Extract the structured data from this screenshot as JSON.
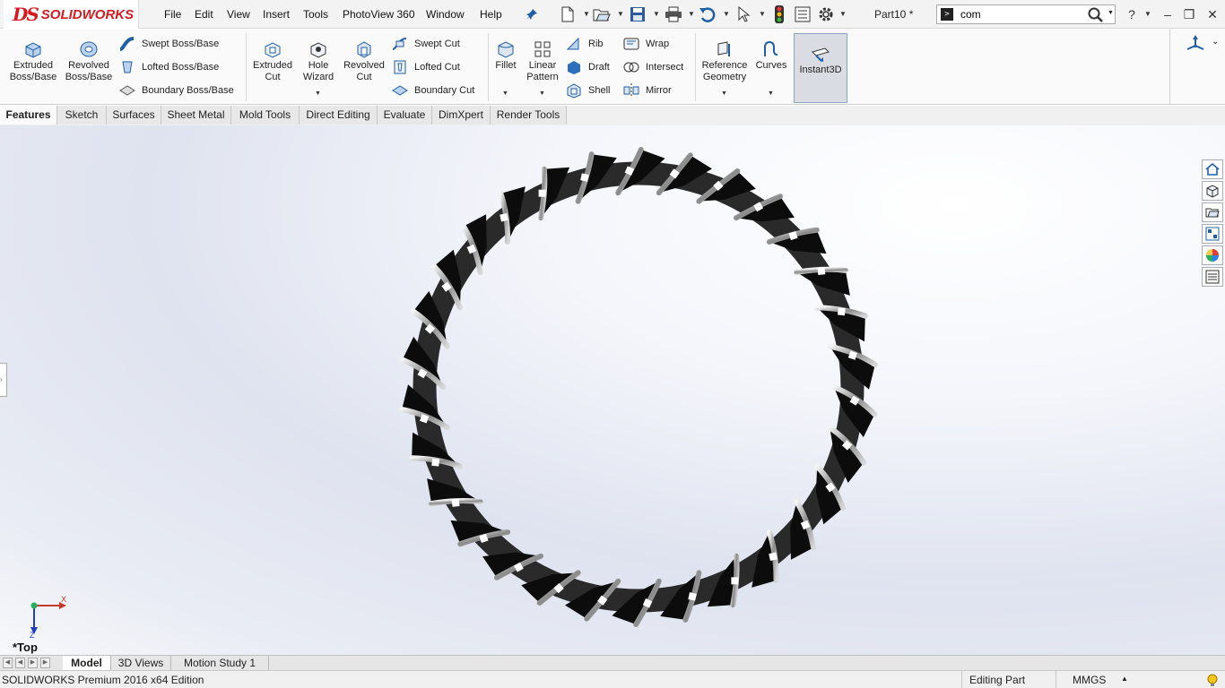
{
  "app": {
    "logo_ds": "DS",
    "logo_word": "SOLIDWORKS",
    "document_title": "Part10 *"
  },
  "menu": [
    "File",
    "Edit",
    "View",
    "Insert",
    "Tools",
    "PhotoView 360",
    "Window",
    "Help"
  ],
  "search": {
    "value": "com"
  },
  "command_manager": {
    "extruded_boss": "Extruded Boss/Base",
    "revolved_boss": "Revolved Boss/Base",
    "swept_boss": "Swept Boss/Base",
    "lofted_boss": "Lofted Boss/Base",
    "boundary_boss": "Boundary Boss/Base",
    "extruded_cut": "Extruded Cut",
    "hole_wizard": "Hole Wizard",
    "revolved_cut": "Revolved Cut",
    "swept_cut": "Swept Cut",
    "lofted_cut": "Lofted Cut",
    "boundary_cut": "Boundary Cut",
    "fillet": "Fillet",
    "linear_pattern": "Linear Pattern",
    "rib": "Rib",
    "draft": "Draft",
    "shell": "Shell",
    "wrap": "Wrap",
    "intersect": "Intersect",
    "mirror": "Mirror",
    "reference_geometry": "Reference Geometry",
    "curves": "Curves",
    "instant3d": "Instant3D"
  },
  "tabs": [
    "Features",
    "Sketch",
    "Surfaces",
    "Sheet Metal",
    "Mold Tools",
    "Direct Editing",
    "Evaluate",
    "DimXpert",
    "Render Tools"
  ],
  "active_tab": "Features",
  "viewport": {
    "view_name": "*Top",
    "triad_x": "X",
    "triad_z": "Z"
  },
  "task_pane_icons": [
    "home-icon",
    "parts-icon",
    "folder-icon",
    "view-palette-icon",
    "appearances-icon",
    "custom-properties-icon"
  ],
  "bottom_tabs": [
    "Model",
    "3D Views",
    "Motion Study 1"
  ],
  "active_bottom_tab": "Model",
  "status": {
    "edition": "SOLIDWORKS Premium 2016 x64 Edition",
    "mode": "Editing Part",
    "units": "MMGS"
  },
  "colors": {
    "brand_red": "#d71920",
    "accent_blue": "#1f5fa8"
  }
}
